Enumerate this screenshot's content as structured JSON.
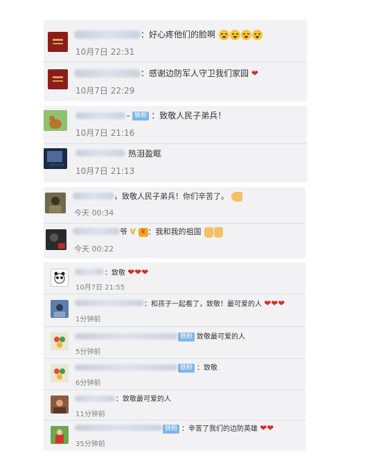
{
  "colors": {
    "heart": "#e0291d",
    "badge": "#7fb5e8",
    "panel": "#f2f2f5"
  },
  "sections": [
    {
      "comments": [
        {
          "text": "：好心疼他们的脸啊",
          "time": "10月7日 22:31",
          "avatar": "red-seal-avatar",
          "emoji": "crying-face-emoji x4"
        },
        {
          "text": "：感谢边防军人守卫我们家园",
          "time": "10月7日 22:29",
          "avatar": "red-seal-avatar",
          "emoji": "heart-emoji"
        }
      ]
    },
    {
      "comments": [
        {
          "name_tail": "-",
          "badge": "铁粉",
          "text": "：致敬人民子弟兵！",
          "time": "10月7日 21:16",
          "avatar": "deer-cartoon-avatar"
        },
        {
          "name_tail": "",
          "text": "热泪盈眶",
          "time": "10月7日 21:13",
          "avatar": "night-window-avatar"
        }
      ]
    },
    {
      "comments": [
        {
          "text": "，致敬人民子弟兵！你们辛苦了。",
          "time": "今天 00:34",
          "avatar": "outdoor-photo-avatar",
          "emoji": "flexed-arm-emoji"
        },
        {
          "name_tail": "爷",
          "text": "：我和我的祖国",
          "time": "今天 00:22",
          "avatar": "dark-photo-avatar",
          "emoji": "thumbs-up-emoji x2"
        }
      ]
    },
    {
      "comments": [
        {
          "text": "：致敬",
          "time": "10月7日 21:55",
          "avatar": "panda-avatar",
          "emoji": "heart-emoji x3"
        },
        {
          "text": "：和孩子一起看了，致敬！最可爱的人",
          "time": "1分钟前",
          "avatar": "blue-photo-avatar",
          "emoji": "heart-emoji x3"
        },
        {
          "badge": "铁粉",
          "text": "致敬最可爱的人",
          "time": "5分钟前",
          "avatar": "colorful-avatar"
        },
        {
          "badge": "铁粉",
          "text": "：致敬",
          "time": "6分钟前",
          "avatar": "colorful-avatar-2"
        },
        {
          "text": "：致敬最可爱的人",
          "time": "11分钟前",
          "avatar": "brown-photo-avatar"
        },
        {
          "badge": "铁粉",
          "text": "：辛苦了我们的边防英雄",
          "time": "35分钟前",
          "avatar": "red-figure-avatar",
          "emoji": "heart-emoji x2"
        }
      ]
    }
  ]
}
